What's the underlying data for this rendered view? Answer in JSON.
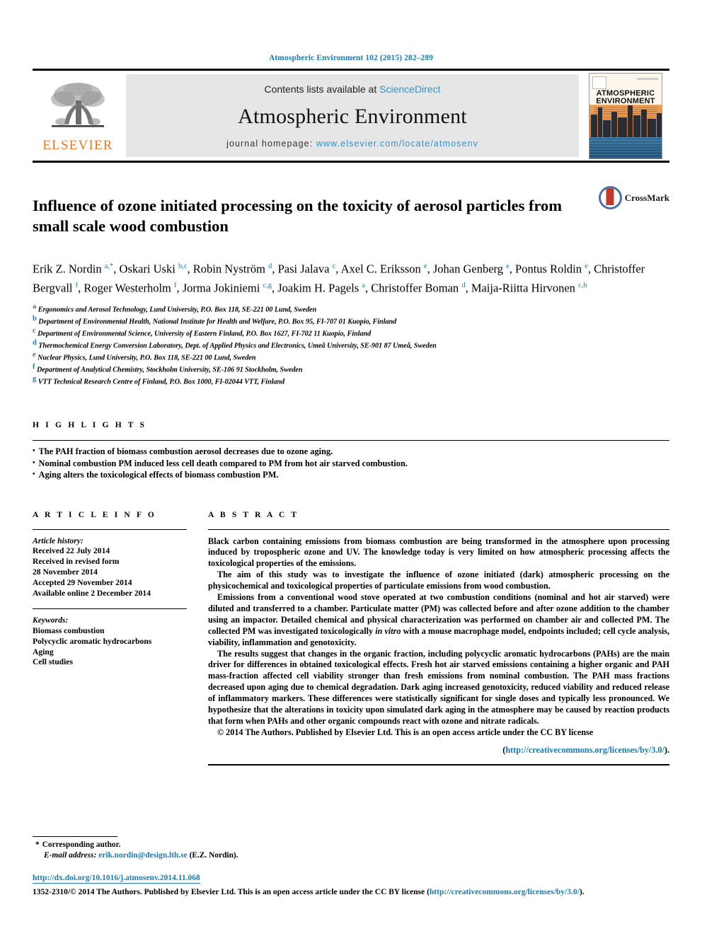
{
  "running_head": "Atmospheric Environment 102 (2015) 282–289",
  "masthead": {
    "publisher_logo_label": "ELSEVIER",
    "contents_prefix": "Contents lists available at",
    "contents_source": "ScienceDirect",
    "journal_title": "Atmospheric Environment",
    "homepage_prefix": "journal homepage:",
    "homepage_url": "www.elsevier.com/locate/atmosenv",
    "cover": {
      "line1": "ATMOSPHERIC",
      "line2": "ENVIRONMENT"
    }
  },
  "article": {
    "title": "Influence of ozone initiated processing on the toxicity of aerosol particles from small scale wood combustion",
    "crossmark_label": "CrossMark",
    "authors_html": "Erik Z. Nordin <sup>a,&#42;</sup>, Oskari Uski <sup>b,c</sup>, Robin Nyström <sup>d</sup>, Pasi Jalava <sup>c</sup>, Axel C. Eriksson <sup>e</sup>, Johan Genberg <sup>e</sup>, Pontus Roldin <sup>e</sup>, Christoffer Bergvall <sup>f</sup>, Roger Westerholm <sup>f</sup>, Jorma Jokiniemi <sup>c,g</sup>, Joakim H. Pagels <sup>a</sup>, Christoffer Boman <sup>d</sup>, Maija-Riitta Hirvonen <sup>c,b</sup>",
    "affiliations": [
      {
        "marker": "a",
        "text": "Ergonomics and Aerosol Technology, Lund University, P.O. Box 118, SE-221 00 Lund, Sweden"
      },
      {
        "marker": "b",
        "text": "Department of Environmental Health, National Institute for Health and Welfare, P.O. Box 95, FI-707 01 Kuopio, Finland"
      },
      {
        "marker": "c",
        "text": "Department of Environmental Science, University of Eastern Finland, P.O. Box 1627, FI-702 11 Kuopio, Finland"
      },
      {
        "marker": "d",
        "text": "Thermochemical Energy Conversion Laboratory, Dept. of Applied Physics and Electronics, Umeå University, SE-901 87 Umeå, Sweden"
      },
      {
        "marker": "e",
        "text": "Nuclear Physics, Lund University, P.O. Box 118, SE-221 00 Lund, Sweden"
      },
      {
        "marker": "f",
        "text": "Department of Analytical Chemistry, Stockholm University, SE-106 91 Stockholm, Sweden"
      },
      {
        "marker": "g",
        "text": "VTT Technical Research Centre of Finland, P.O. Box 1000, FI-02044 VTT, Finland"
      }
    ]
  },
  "highlights": {
    "label": "H I G H L I G H T S",
    "bullet": "•",
    "items": [
      "The PAH fraction of biomass combustion aerosol decreases due to ozone aging.",
      "Nominal combustion PM induced less cell death compared to PM from hot air starved combustion.",
      "Aging alters the toxicological effects of biomass combustion PM."
    ]
  },
  "article_info": {
    "label": "A R T I C L E   I N F O",
    "history_heading": "Article history:",
    "history_lines": [
      "Received 22 July 2014",
      "Received in revised form",
      "28 November 2014",
      "Accepted 29 November 2014",
      "Available online 2 December 2014"
    ],
    "keywords_heading": "Keywords:",
    "keywords": [
      "Biomass combustion",
      "Polycyclic aromatic hydrocarbons",
      "Aging",
      "Cell studies"
    ]
  },
  "abstract": {
    "label": "A B S T R A C T",
    "paragraphs": [
      "Black carbon containing emissions from biomass combustion are being transformed in the atmosphere upon processing induced by tropospheric ozone and UV. The knowledge today is very limited on how atmospheric processing affects the toxicological properties of the emissions.",
      "The aim of this study was to investigate the influence of ozone initiated (dark) atmospheric processing on the physicochemical and toxicological properties of particulate emissions from wood combustion.",
      "Emissions from a conventional wood stove operated at two combustion conditions (nominal and hot air starved) were diluted and transferred to a chamber. Particulate matter (PM) was collected before and after ozone addition to the chamber using an impactor. Detailed chemical and physical characterization was performed on chamber air and collected PM. The collected PM was investigated toxicologically in vitro with a mouse macrophage model, endpoints included; cell cycle analysis, viability, inflammation and genotoxicity.",
      "The results suggest that changes in the organic fraction, including polycyclic aromatic hydrocarbons (PAHs) are the main driver for differences in obtained toxicological effects. Fresh hot air starved emissions containing a higher organic and PAH mass-fraction affected cell viability stronger than fresh emissions from nominal combustion. The PAH mass fractions decreased upon aging due to chemical degradation. Dark aging increased genotoxicity, reduced viability and reduced release of inflammatory markers. These differences were statistically significant for single doses and typically less pronounced. We hypothesize that the alterations in toxicity upon simulated dark aging in the atmosphere may be caused by reaction products that form when PAHs and other organic compounds react with ozone and nitrate radicals."
    ],
    "italic_phrase": "in vitro",
    "copyright": "© 2014 The Authors. Published by Elsevier Ltd. This is an open access article under the CC BY license",
    "cc_url_open": "(",
    "cc_url": "http://creativecommons.org/licenses/by/3.0/",
    "cc_url_close": ")."
  },
  "footer": {
    "corresponding_star": "*",
    "corresponding_label": "Corresponding author.",
    "email_label": "E-mail address:",
    "email": "erik.nordin@design.lth.se",
    "email_suffix": "(E.Z. Nordin).",
    "doi": "http://dx.doi.org/10.1016/j.atmosenv.2014.11.068",
    "issn_prefix": "1352-2310/© 2014 The Authors. Published by Elsevier Ltd. This is an open access article under the CC BY license (",
    "issn_link": "http://creativecommons.org/licenses/by/3.0/",
    "issn_suffix": ")."
  },
  "colors": {
    "link": "#1a7bb0",
    "elsevier_orange": "#E87722",
    "masthead_bg": "#e6e6e6"
  }
}
